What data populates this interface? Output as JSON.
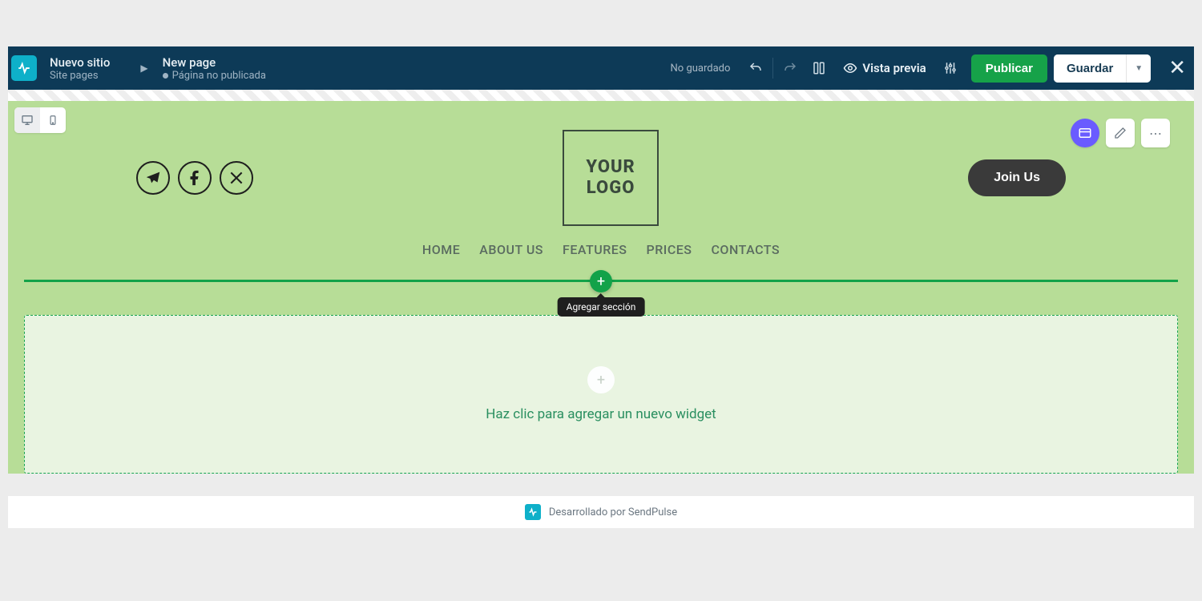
{
  "breadcrumb": {
    "site_title": "Nuevo sitio",
    "site_sub": "Site pages",
    "page_title": "New page",
    "page_status": "Página no publicada"
  },
  "topbar": {
    "unsaved": "No guardado",
    "preview": "Vista previa",
    "publish": "Publicar",
    "save": "Guardar"
  },
  "template": {
    "logo_line1": "YOUR",
    "logo_line2": "LOGO",
    "join_button": "Join Us",
    "nav": [
      "HOME",
      "ABOUT US",
      "FEATURES",
      "PRICES",
      "CONTACTS"
    ]
  },
  "editor": {
    "add_section_tooltip": "Agregar sección",
    "widget_hint": "Haz clic para agregar un nuevo widget"
  },
  "footer": {
    "powered": "Desarrollado por SendPulse"
  }
}
